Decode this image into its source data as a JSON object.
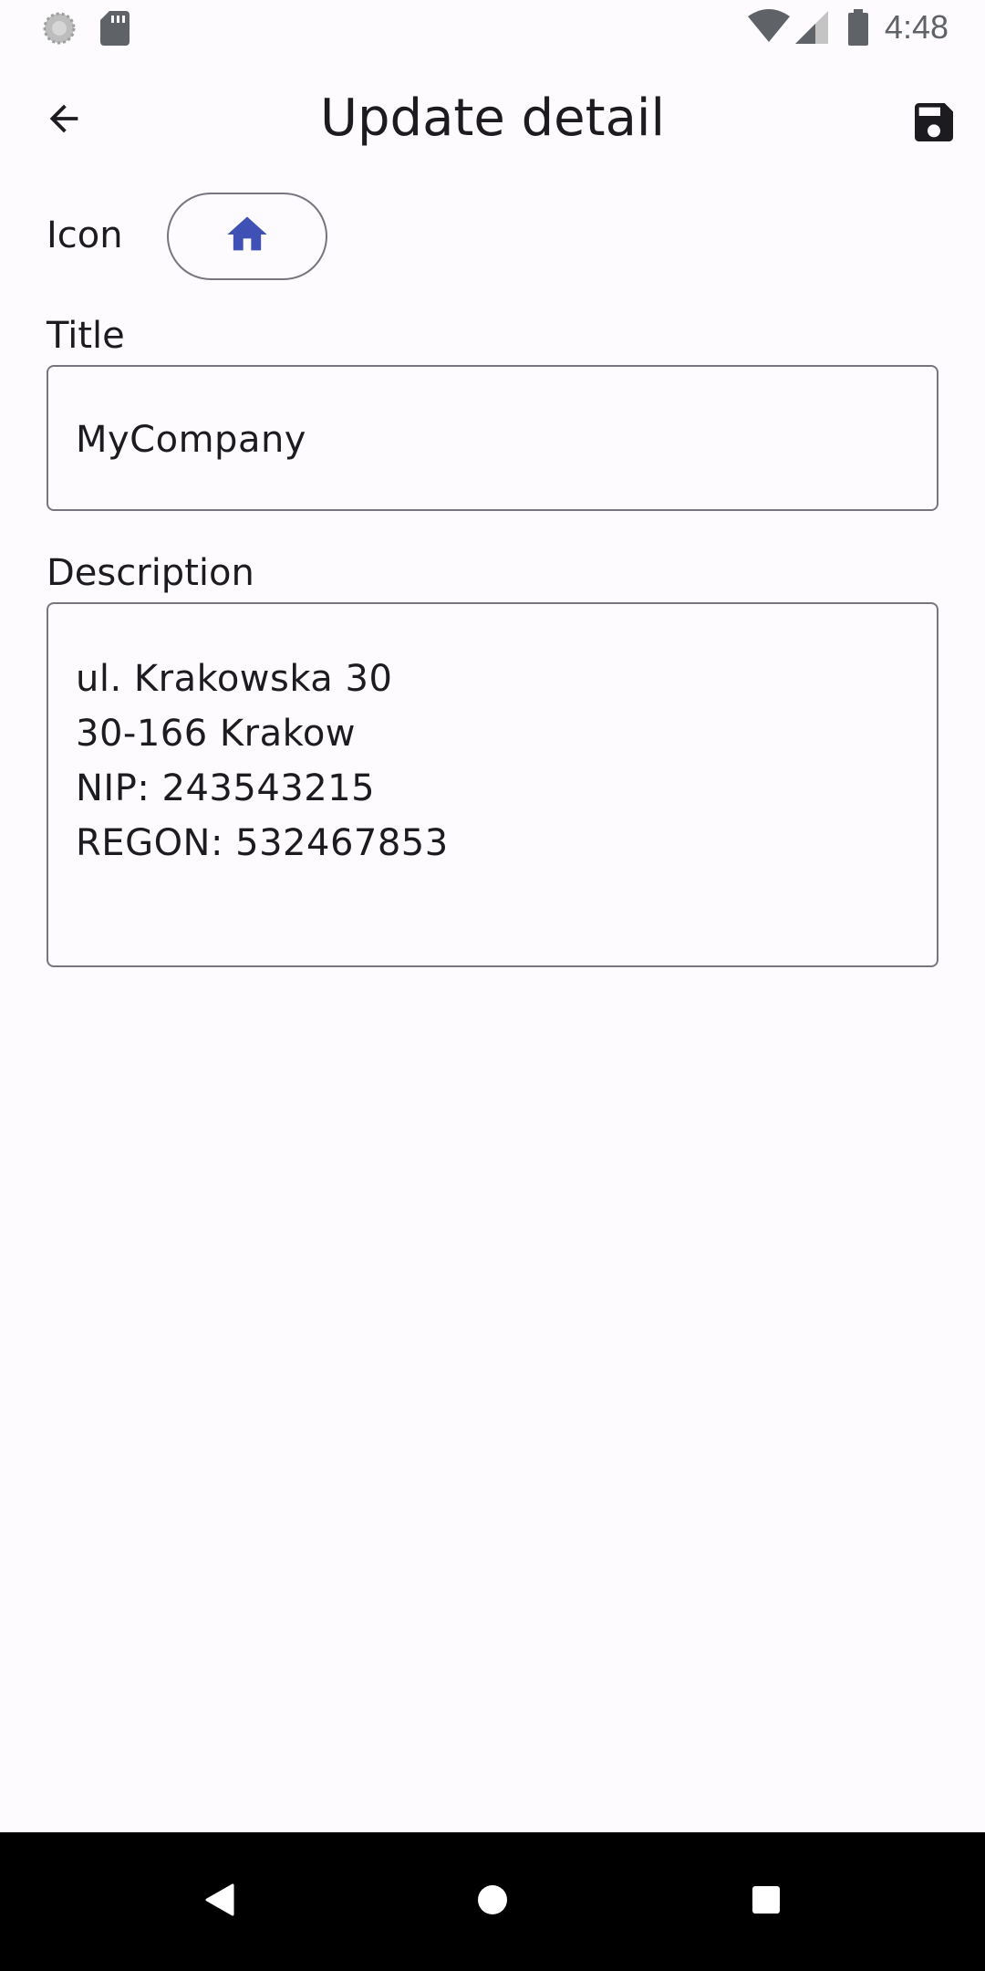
{
  "status_bar": {
    "time": "4:48",
    "icons": [
      "sync-icon",
      "sd-card-icon",
      "wifi-icon",
      "cell-signal-icon",
      "battery-icon"
    ]
  },
  "app_bar": {
    "title": "Update detail",
    "back_icon": "arrow-back-icon",
    "save_icon": "save-icon"
  },
  "form": {
    "icon_label": "Icon",
    "selected_icon": "home-icon",
    "title_label": "Title",
    "title_value": "MyCompany",
    "description_label": "Description",
    "description_lines": [
      "ul. Krakowska 30",
      "30-166 Krakow",
      "NIP: 243543215",
      "REGON: 532467853"
    ]
  },
  "nav_bar": {
    "icons": [
      "nav-back-icon",
      "nav-home-icon",
      "nav-recents-icon"
    ]
  },
  "colors": {
    "background": "#fdfbfe",
    "accent": "#3f51b5",
    "outline": "#79747e",
    "status_icons": "#5f6368",
    "nav_bar": "#000000"
  }
}
